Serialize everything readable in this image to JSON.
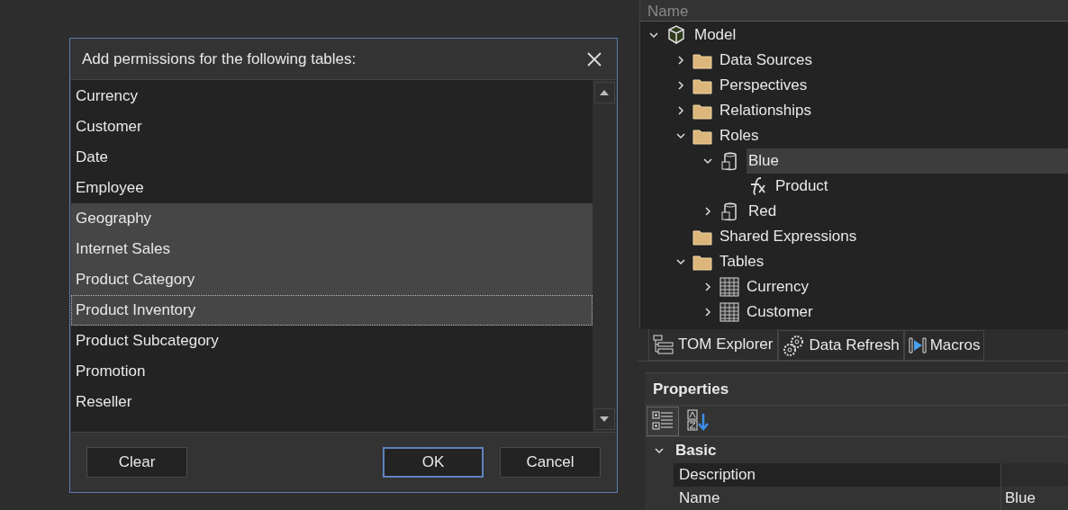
{
  "dialog": {
    "title": "Add permissions for the following tables:",
    "items": [
      {
        "label": "Currency",
        "selected": false,
        "focused": false
      },
      {
        "label": "Customer",
        "selected": false,
        "focused": false
      },
      {
        "label": "Date",
        "selected": false,
        "focused": false
      },
      {
        "label": "Employee",
        "selected": false,
        "focused": false
      },
      {
        "label": "Geography",
        "selected": true,
        "focused": false
      },
      {
        "label": "Internet Sales",
        "selected": true,
        "focused": false
      },
      {
        "label": "Product Category",
        "selected": true,
        "focused": false
      },
      {
        "label": "Product Inventory",
        "selected": true,
        "focused": true
      },
      {
        "label": "Product Subcategory",
        "selected": false,
        "focused": false
      },
      {
        "label": "Promotion",
        "selected": false,
        "focused": false
      },
      {
        "label": "Reseller",
        "selected": false,
        "focused": false
      }
    ],
    "buttons": [
      {
        "label": "Clear",
        "default": false
      },
      {
        "label": "OK",
        "default": true
      },
      {
        "label": "Cancel",
        "default": false
      }
    ]
  },
  "tree": {
    "header": "Name",
    "nodes": [
      {
        "label": "Model",
        "kind": "model",
        "expanded": true,
        "selected": false,
        "children": [
          {
            "label": "Data Sources",
            "kind": "folder",
            "expanded": false,
            "selected": false
          },
          {
            "label": "Perspectives",
            "kind": "folder",
            "expanded": false,
            "selected": false
          },
          {
            "label": "Relationships",
            "kind": "folder",
            "expanded": false,
            "selected": false
          },
          {
            "label": "Roles",
            "kind": "folder",
            "expanded": true,
            "selected": false,
            "children": [
              {
                "label": "Blue",
                "kind": "role",
                "expanded": true,
                "selected": true,
                "children": [
                  {
                    "label": "Product",
                    "kind": "filter",
                    "selected": false
                  }
                ]
              },
              {
                "label": "Red",
                "kind": "role",
                "expanded": false,
                "selected": false
              }
            ]
          },
          {
            "label": "Shared Expressions",
            "kind": "folder",
            "selected": false
          },
          {
            "label": "Tables",
            "kind": "folder",
            "expanded": true,
            "selected": false,
            "children": [
              {
                "label": "Currency",
                "kind": "table",
                "expanded": false,
                "selected": false
              },
              {
                "label": "Customer",
                "kind": "table",
                "expanded": false,
                "selected": false
              }
            ]
          }
        ]
      }
    ]
  },
  "tabs": [
    {
      "label": "TOM Explorer",
      "kind": "tree",
      "selected": true
    },
    {
      "label": "Data Refresh",
      "kind": "gears",
      "selected": false
    },
    {
      "label": "Macros",
      "kind": "macro",
      "selected": false
    }
  ],
  "properties": {
    "title": "Properties",
    "tools": [
      {
        "kind": "categorized",
        "selected": true
      },
      {
        "kind": "alphabetical",
        "selected": false
      }
    ],
    "category": "Basic",
    "rows": [
      {
        "name": "Description",
        "value": "",
        "selected": true
      },
      {
        "name": "Name",
        "value": "Blue",
        "selected": false
      }
    ]
  }
}
